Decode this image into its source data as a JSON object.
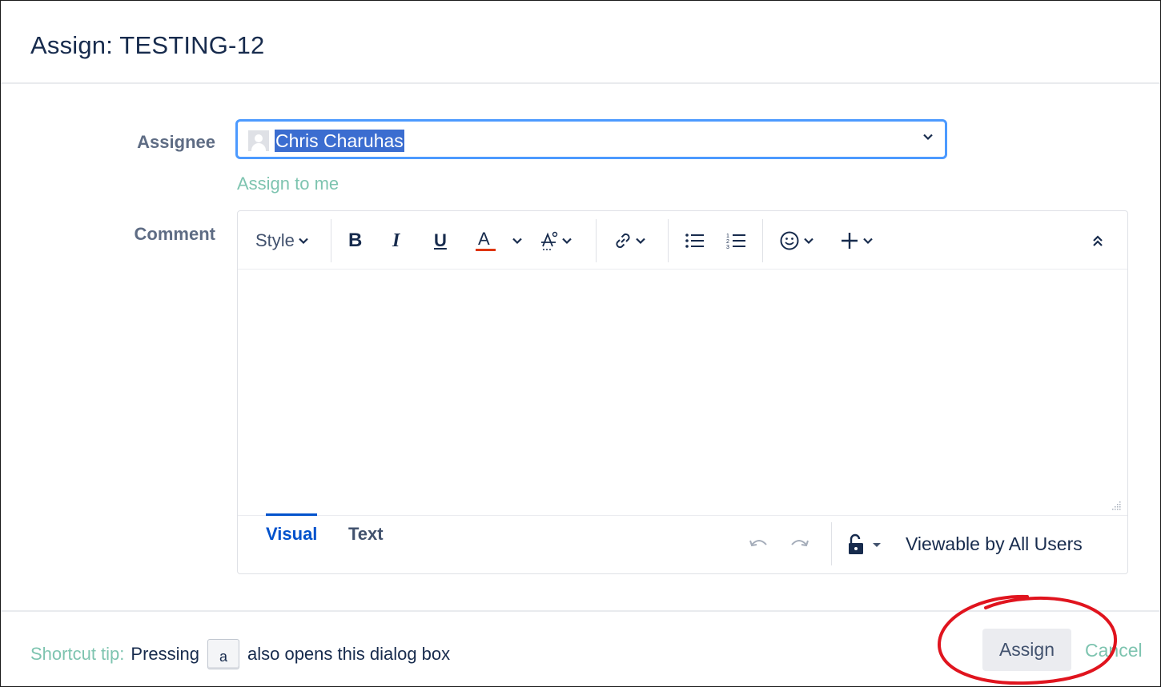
{
  "dialog": {
    "title": "Assign: TESTING-12"
  },
  "form": {
    "assignee_label": "Assignee",
    "assignee_value": "Chris Charuhas",
    "assign_to_me_label": "Assign to me",
    "comment_label": "Comment"
  },
  "editor": {
    "toolbar": {
      "style_label": "Style",
      "text_color_underline": "#de350b"
    },
    "tabs": {
      "visual_label": "Visual",
      "text_label": "Text"
    },
    "visibility_label": "Viewable by All Users"
  },
  "footer": {
    "tip_label": "Shortcut tip:",
    "tip_pressing": "Pressing",
    "tip_key": "a",
    "tip_suffix": "also opens this dialog box",
    "assign_button": "Assign",
    "cancel_link": "Cancel"
  },
  "colors": {
    "accent_link": "#7ec4b0",
    "focus_border": "#4c9aff",
    "selection": "#3b6dd0",
    "annotation": "#e0141e"
  }
}
